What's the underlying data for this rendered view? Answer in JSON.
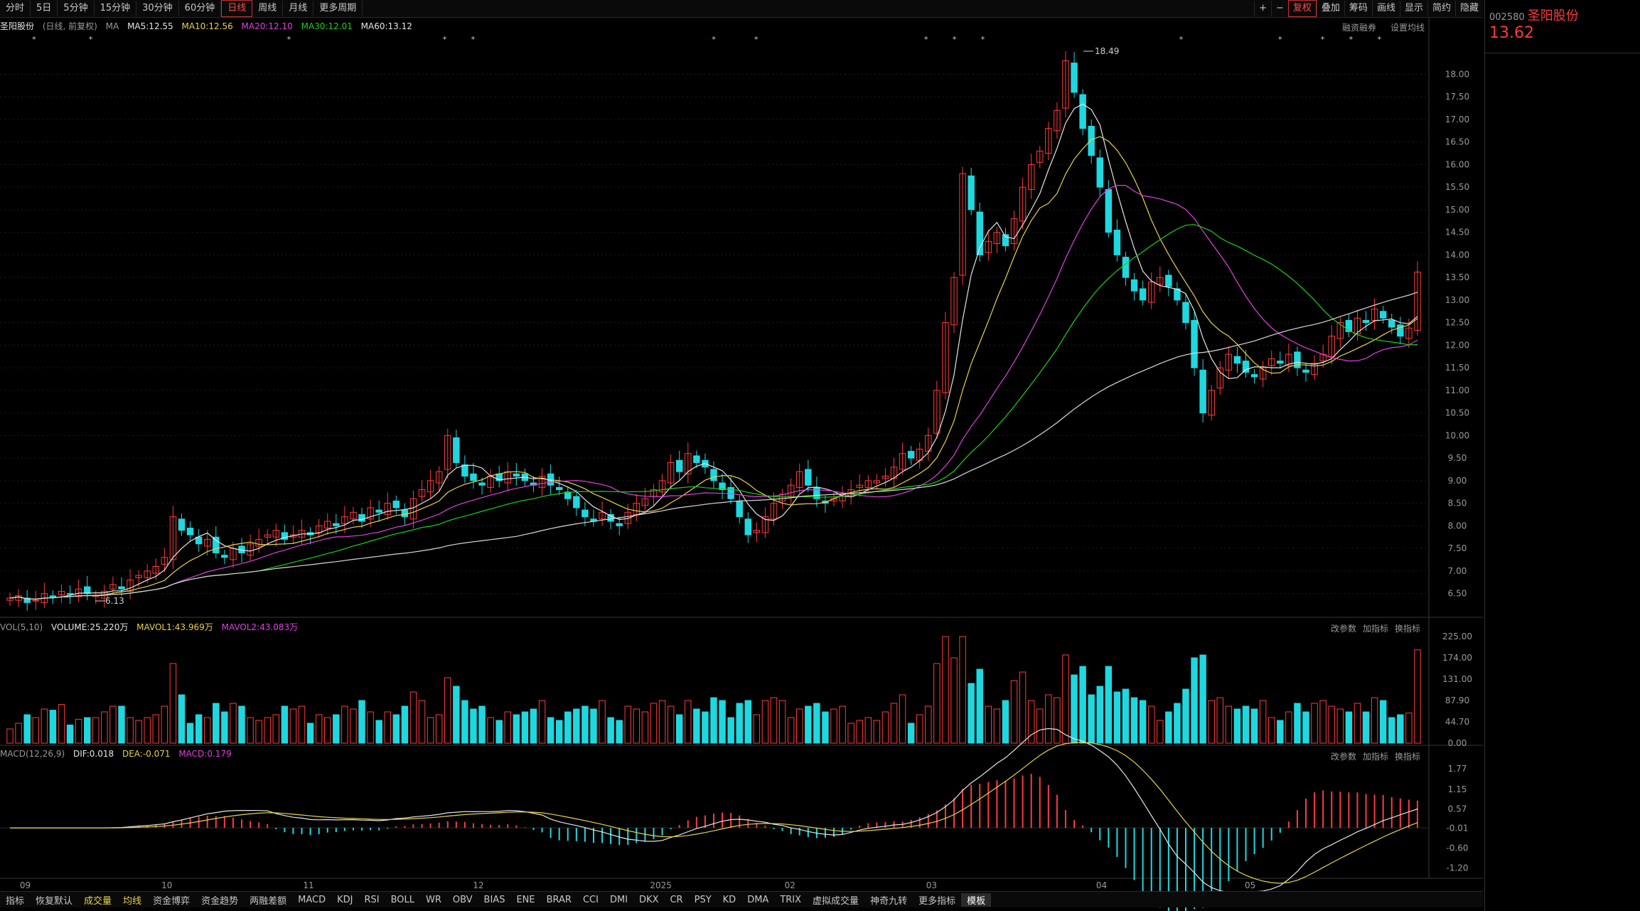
{
  "toolbar": {
    "periods": [
      "分时",
      "5日",
      "5分钟",
      "15分钟",
      "30分钟",
      "60分钟",
      "日线",
      "周线",
      "月线",
      "更多周期"
    ],
    "active_period": "日线",
    "right_buttons": [
      "+",
      "−",
      "复权",
      "叠加",
      "筹码",
      "画线",
      "显示",
      "简约",
      "隐藏"
    ]
  },
  "header": {
    "name": "圣阳股份",
    "mode": "(日线, 前复权)",
    "ma_label": "MA",
    "ma5": "MA5:12.55",
    "ma10": "MA10:12.56",
    "ma20": "MA20:12.10",
    "ma30": "MA30:12.01",
    "ma60": "MA60:13.12",
    "right_links": [
      "融资融券",
      "设置均线"
    ],
    "high_label": "18.49",
    "low_label": "6.13"
  },
  "vol_header": {
    "title": "VOL(5,10)",
    "volume": "VOLUME:25.220万",
    "mavol1": "MAVOL1:43.969万",
    "mavol2": "MAVOL2:43.083万",
    "links": [
      "改参数",
      "加指标",
      "换指标"
    ]
  },
  "macd_header": {
    "title": "MACD(12,26,9)",
    "dif": "DIF:0.018",
    "dea": "DEA:-0.071",
    "macd": "MACD:0.179",
    "links": [
      "改参数",
      "加指标",
      "换指标"
    ]
  },
  "bottom": {
    "items": [
      "指标",
      "恢复默认",
      "成交量",
      "均线",
      "资金博弈",
      "资金趋势",
      "两融差额",
      "MACD",
      "KDJ",
      "RSI",
      "BOLL",
      "WR",
      "OBV",
      "BIAS",
      "ENE",
      "BRAR",
      "CCI",
      "DMI",
      "DKX",
      "CR",
      "PSY",
      "KD",
      "DMA",
      "TRIX",
      "虚拟成交量",
      "神奇九转",
      "更多指标",
      "模板"
    ]
  },
  "chart_data": {
    "type": "candlestick",
    "price_axis": [
      "18.00",
      "17.50",
      "17.00",
      "16.50",
      "16.00",
      "15.50",
      "15.00",
      "14.50",
      "14.00",
      "13.50",
      "13.00",
      "12.50",
      "12.00",
      "11.50",
      "11.00",
      "10.50",
      "10.00",
      "9.50",
      "9.00",
      "8.50",
      "8.00",
      "7.50",
      "7.00",
      "6.50"
    ],
    "ylim": [
      6.1,
      18.7
    ],
    "vol_axis": [
      "225.00",
      "174.00",
      "131.00",
      "87.90",
      "44.70",
      "0.00"
    ],
    "macd_axis": [
      "1.77",
      "1.15",
      "0.57",
      "-0.01",
      "-0.60",
      "-1.20"
    ],
    "x_labels": [
      "09",
      "10",
      "11",
      "12",
      "2025",
      "02",
      "03",
      "04",
      "05"
    ],
    "close": [
      6.4,
      6.45,
      6.3,
      6.35,
      6.5,
      6.42,
      6.55,
      6.48,
      6.6,
      6.5,
      6.45,
      6.55,
      6.7,
      6.6,
      6.8,
      6.9,
      7.0,
      7.1,
      7.3,
      8.2,
      7.9,
      7.8,
      7.6,
      7.7,
      7.4,
      7.3,
      7.5,
      7.4,
      7.6,
      7.7,
      7.8,
      7.9,
      7.7,
      7.8,
      7.9,
      7.8,
      8.0,
      8.1,
      8.0,
      8.2,
      8.3,
      8.1,
      8.4,
      8.3,
      8.5,
      8.4,
      8.2,
      8.6,
      8.8,
      9.0,
      9.2,
      10.0,
      9.4,
      9.1,
      9.0,
      8.9,
      9.1,
      9.0,
      9.2,
      9.1,
      9.0,
      8.9,
      9.1,
      8.9,
      8.8,
      8.6,
      8.4,
      8.2,
      8.1,
      8.3,
      8.1,
      8.0,
      8.3,
      8.5,
      8.6,
      8.8,
      9.0,
      9.4,
      9.2,
      9.6,
      9.4,
      9.3,
      9.0,
      8.8,
      8.6,
      8.2,
      7.8,
      7.9,
      8.2,
      8.5,
      8.7,
      8.9,
      9.2,
      8.9,
      8.6,
      8.5,
      8.6,
      8.7,
      8.8,
      8.9,
      9.0,
      9.0,
      9.1,
      9.3,
      9.6,
      9.5,
      9.7,
      10.0,
      11.0,
      12.5,
      13.5,
      15.8,
      15.0,
      14.0,
      14.3,
      14.5,
      14.2,
      14.8,
      15.5,
      16.0,
      16.3,
      16.8,
      17.2,
      18.3,
      17.6,
      16.8,
      16.2,
      15.5,
      14.5,
      14.0,
      13.5,
      13.2,
      13.0,
      13.4,
      13.5,
      13.3,
      13.0,
      12.5,
      11.5,
      10.5,
      11.0,
      11.5,
      11.8,
      11.6,
      11.4,
      11.3,
      11.5,
      11.7,
      11.6,
      11.8,
      11.5,
      11.4,
      11.6,
      11.8,
      12.2,
      12.5,
      12.3,
      12.6,
      12.5,
      12.8,
      12.6,
      12.4,
      12.2,
      12.38,
      13.62
    ]
  }
}
